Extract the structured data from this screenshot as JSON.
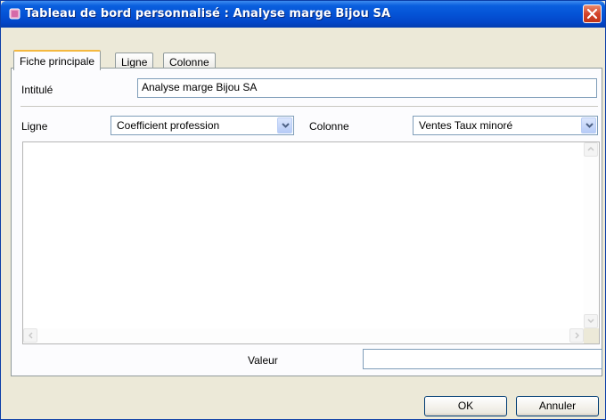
{
  "window": {
    "title": "Tableau de bord personnalisé : Analyse marge Bijou SA"
  },
  "tabs": [
    "Fiche principale",
    "Ligne",
    "Colonne"
  ],
  "form": {
    "intitule_label": "Intitulé",
    "intitule_value": "Analyse marge Bijou SA",
    "ligne_label": "Ligne",
    "ligne_value": "Coefficient profession",
    "colonne_label": "Colonne",
    "colonne_value": "Ventes Taux minoré",
    "valeur_label": "Valeur",
    "valeur_value": ""
  },
  "buttons": {
    "ok": "OK",
    "cancel": "Annuler"
  },
  "colors": {
    "titlebar": "#0453d6",
    "active_tab_accent": "#f4b840",
    "close_button": "#d3432a"
  }
}
